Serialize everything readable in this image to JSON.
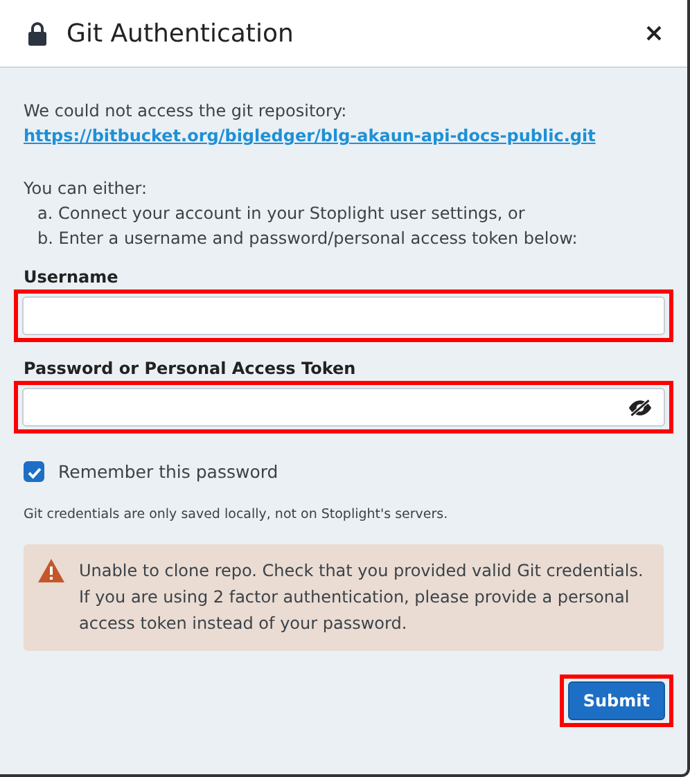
{
  "dialog": {
    "title": "Git Authentication"
  },
  "intro": {
    "text": "We could not access the git repository:",
    "link": "https://bitbucket.org/bigledger/blg-akaun-api-docs-public.git"
  },
  "options": {
    "lead": "You can either:",
    "items": [
      "a. Connect your account in your Stoplight user settings, or",
      "b. Enter a username and password/personal access token below:"
    ]
  },
  "fields": [
    {
      "kind": "text",
      "label": "Username",
      "highlighted": true
    },
    {
      "kind": "password",
      "label": "Password or Personal Access Token",
      "highlighted": true
    }
  ],
  "remember": {
    "label": "Remember this password",
    "checked": true
  },
  "note": "Git credentials are only saved locally, not on Stoplight's servers.",
  "alert": {
    "text": "Unable to clone repo. Check that you provided valid Git credentials. If you are using 2 factor authentication, please provide a personal access token instead of your password."
  },
  "submit": {
    "label": "Submit",
    "highlighted": true
  }
}
